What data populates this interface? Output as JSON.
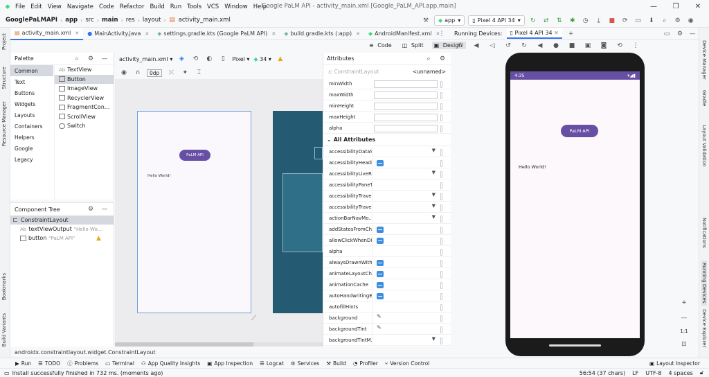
{
  "menu": {
    "items": [
      "File",
      "Edit",
      "View",
      "Navigate",
      "Code",
      "Refactor",
      "Build",
      "Run",
      "Tools",
      "VCS",
      "Window",
      "Help"
    ],
    "window_title": "Google PaLM API - activity_main.xml [Google_PaLM_API.app.main]"
  },
  "nav": {
    "project": "GooglePaLMAPI",
    "crumbs": [
      "app",
      "src",
      "main",
      "res",
      "layout",
      "activity_main.xml"
    ],
    "run_config": "app",
    "device": "Pixel 4 API 34"
  },
  "tabs": [
    {
      "label": "activity_main.xml",
      "active": true
    },
    {
      "label": "MainActivity.java",
      "active": false
    },
    {
      "label": "settings.gradle.kts (Google PaLM API)",
      "active": false
    },
    {
      "label": "build.gradle.kts (:app)",
      "active": false
    },
    {
      "label": "AndroidManifest.xml",
      "active": false
    }
  ],
  "view_modes": {
    "code": "Code",
    "split": "Split",
    "design": "Design"
  },
  "palette": {
    "title": "Palette",
    "categories": [
      "Common",
      "Text",
      "Buttons",
      "Widgets",
      "Layouts",
      "Containers",
      "Helpers",
      "Google",
      "Legacy"
    ],
    "items": [
      {
        "prefix": "Ab",
        "label": "TextView"
      },
      {
        "prefix": "",
        "label": "Button"
      },
      {
        "prefix": "",
        "label": "ImageView"
      },
      {
        "prefix": "",
        "label": "RecyclerView"
      },
      {
        "prefix": "",
        "label": "FragmentCon..."
      },
      {
        "prefix": "",
        "label": "ScrollView"
      },
      {
        "prefix": "",
        "label": "Switch"
      }
    ]
  },
  "component_tree": {
    "title": "Component Tree",
    "root": "ConstraintLayout",
    "children": [
      {
        "prefix": "Ab",
        "label": "textViewOutput",
        "hint": "\"Hello Wo...",
        "warn": false
      },
      {
        "prefix": "",
        "label": "button",
        "hint": "\"PaLM API\"",
        "warn": true
      }
    ]
  },
  "design_toolbar": {
    "file": "activity_main.xml",
    "device": "Pixel",
    "api": "34",
    "margin": "0dp"
  },
  "design_preview": {
    "button_text": "PaLM API",
    "hello_text": "Hello World!"
  },
  "attributes": {
    "title": "Attributes",
    "search_placeholder": "ConstraintLayout",
    "id_value": "<unnamed>",
    "top_rows": [
      "minWidth",
      "maxWidth",
      "minHeight",
      "maxHeight",
      "alpha"
    ],
    "all_title": "All Attributes",
    "all_rows": [
      {
        "k": "accessibilityDataS...",
        "t": "dropdown"
      },
      {
        "k": "accessibilityHeadi...",
        "t": "bool"
      },
      {
        "k": "accessibilityLiveRe...",
        "t": "dropdown"
      },
      {
        "k": "accessibilityPaneT...",
        "t": "flag"
      },
      {
        "k": "accessibilityTrave...",
        "t": "dropdown"
      },
      {
        "k": "accessibilityTrave...",
        "t": "dropdown"
      },
      {
        "k": "actionBarNavMo...",
        "t": "dropdown"
      },
      {
        "k": "addStatesFromCh...",
        "t": "bool"
      },
      {
        "k": "allowClickWhenDi...",
        "t": "bool"
      },
      {
        "k": "alpha",
        "t": "flag"
      },
      {
        "k": "alwaysDrawnWith...",
        "t": "bool"
      },
      {
        "k": "animateLayoutCh...",
        "t": "bool"
      },
      {
        "k": "animationCache",
        "t": "bool"
      },
      {
        "k": "autoHandwritingE...",
        "t": "bool"
      },
      {
        "k": "autofillHints",
        "t": "flag"
      },
      {
        "k": "background",
        "t": "pick"
      },
      {
        "k": "backgroundTint",
        "t": "pick"
      },
      {
        "k": "backgroundTintM...",
        "t": "dropdown"
      }
    ]
  },
  "running_devices": {
    "label": "Running Devices:",
    "device_tab": "Pixel 4 API 34",
    "time": "4:35",
    "button_text": "PaLM API",
    "hello_text": "Hello World!",
    "zoom_ratio": "1:1"
  },
  "left_strip": [
    "Project",
    "Structure",
    "Resource Manager",
    "Bookmarks",
    "Build Variants"
  ],
  "right_strip": [
    "Device Manager",
    "Gradle",
    "Layout Validation",
    "Notifications",
    "Running Devices",
    "Device Explorer"
  ],
  "breadcrumb_path": "androidx.constraintlayout.widget.ConstraintLayout",
  "bottom_tools": [
    "Run",
    "TODO",
    "Problems",
    "Terminal",
    "App Quality Insights",
    "App Inspection",
    "Logcat",
    "Services",
    "Build",
    "Profiler",
    "Version Control"
  ],
  "layout_inspector": "Layout Inspector",
  "status": {
    "message": "Install successfully finished in 732 ms. (moments ago)",
    "position": "56:54 (37 chars)",
    "line_sep": "LF",
    "encoding": "UTF-8",
    "indent": "4 spaces"
  },
  "colors": {
    "accent": "#3574f0",
    "purple": "#6750a4",
    "blueprint": "#245a72"
  }
}
